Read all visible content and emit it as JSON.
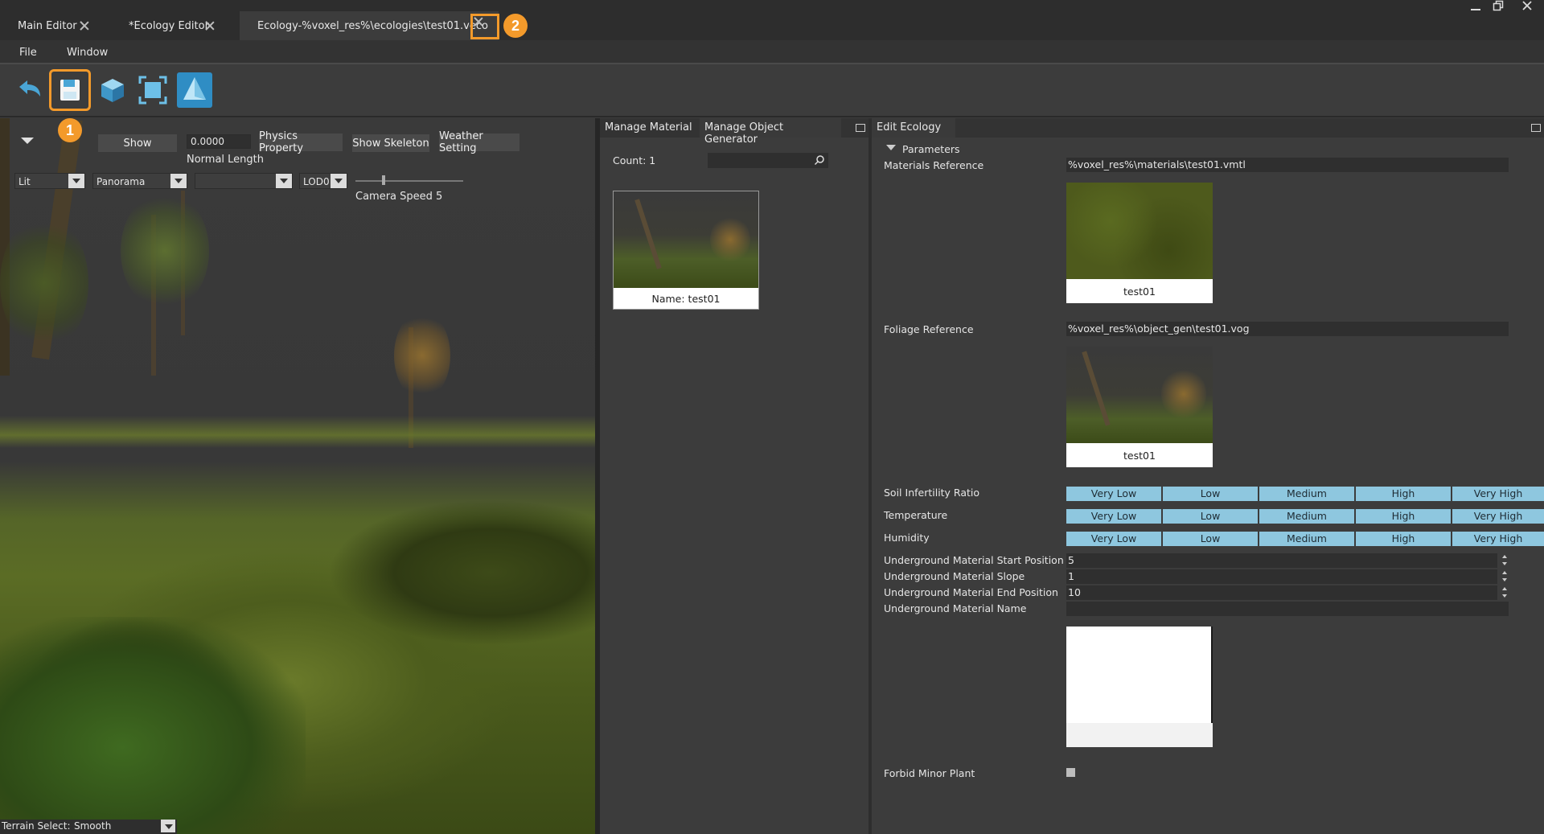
{
  "tabs": [
    {
      "label": "Main Editor"
    },
    {
      "label": "*Ecology Editor"
    },
    {
      "label": "Ecology-%voxel_res%\\ecologies\\test01.veco"
    }
  ],
  "badges": {
    "one": "1",
    "two": "2"
  },
  "menu": {
    "file": "File",
    "window": "Window"
  },
  "toolbar": {
    "icons": [
      "undo-icon",
      "save-icon",
      "cube-icon",
      "focus-icon",
      "terrain-icon"
    ],
    "accent": "#f39a2b"
  },
  "viewport": {
    "show_label": "Show",
    "normal_length_value": "0.0000",
    "normal_length_label": "Normal Length",
    "physics_property": "Physics Property",
    "show_skeleton": "Show Skeleton",
    "weather_setting": "Weather Setting",
    "lit": "Lit",
    "panorama": "Panorama",
    "empty_select": "",
    "lod": "LOD0",
    "camera_speed": "Camera Speed 5",
    "terrain_select_label": "Terrain Select:",
    "terrain_select_value": "Smooth"
  },
  "middle": {
    "tab_material": "Manage Material",
    "tab_object_gen": "Manage Object Generator",
    "count": "Count: 1",
    "search_value": "",
    "card_name": "Name: test01"
  },
  "right": {
    "tab": "Edit Ecology",
    "section": "Parameters",
    "materials_reference_label": "Materials Reference",
    "materials_reference_value": "%voxel_res%\\materials\\test01.vmtl",
    "materials_thumb_caption": "test01",
    "foliage_reference_label": "Foliage Reference",
    "foliage_reference_value": "%voxel_res%\\object_gen\\test01.vog",
    "foliage_thumb_caption": "test01",
    "levels": [
      "Very Low",
      "Low",
      "Medium",
      "High",
      "Very High"
    ],
    "soil_label": "Soil Infertility Ratio",
    "temperature_label": "Temperature",
    "humidity_label": "Humidity",
    "ug_start_label": "Underground Material Start Position",
    "ug_start_value": "5",
    "ug_slope_label": "Underground Material Slope",
    "ug_slope_value": "1",
    "ug_end_label": "Underground Material End Position",
    "ug_end_value": "10",
    "ug_name_label": "Underground Material Name",
    "ug_name_value": "",
    "forbid_minor_plant_label": "Forbid Minor Plant"
  }
}
